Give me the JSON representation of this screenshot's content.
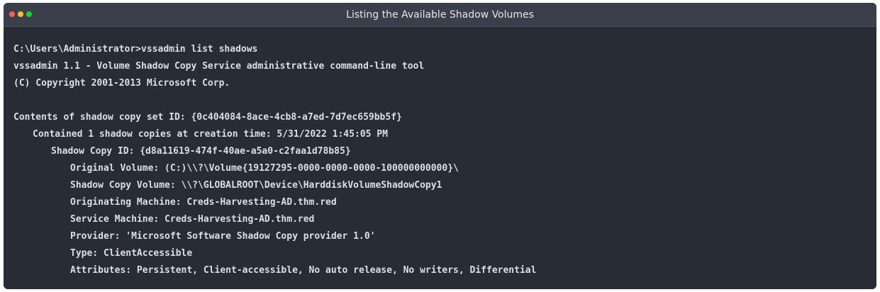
{
  "window": {
    "title": "Listing the Available Shadow Volumes",
    "colors": {
      "background": "#282c34",
      "titlebar": "#3a3f4b",
      "text": "#dcdfe4",
      "close": "#ff5f56",
      "minimize": "#ffbd2e",
      "maximize": "#27c93f"
    }
  },
  "terminal": {
    "lines": [
      "C:\\Users\\Administrator>vssadmin list shadows",
      "vssadmin 1.1 - Volume Shadow Copy Service administrative command-line tool",
      "(C) Copyright 2001-2013 Microsoft Corp.",
      "",
      "Contents of shadow copy set ID: {0c404084-8ace-4cb8-a7ed-7d7ec659bb5f}",
      "Contained 1 shadow copies at creation time: 5/31/2022 1:45:05 PM",
      "Shadow Copy ID: {d8a11619-474f-40ae-a5a0-c2faa1d78b85}",
      "Original Volume: (C:)\\\\?\\Volume{19127295-0000-0000-0000-100000000000}\\",
      "Shadow Copy Volume: \\\\?\\GLOBALROOT\\Device\\HarddiskVolumeShadowCopy1",
      "Originating Machine: Creds-Harvesting-AD.thm.red",
      "Service Machine: Creds-Harvesting-AD.thm.red",
      "Provider: 'Microsoft Software Shadow Copy provider 1.0'",
      "Type: ClientAccessible",
      "Attributes: Persistent, Client-accessible, No auto release, No writers, Differential"
    ]
  }
}
